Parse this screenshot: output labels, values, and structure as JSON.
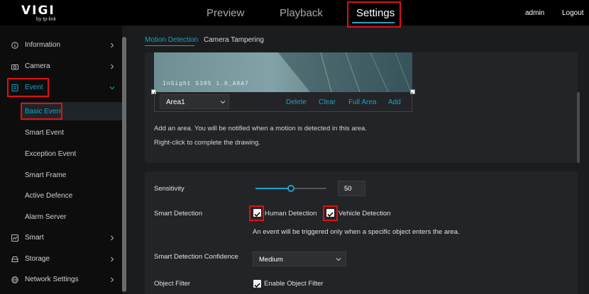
{
  "brand": {
    "name": "VIGI",
    "sub": "by tp-link"
  },
  "nav": {
    "tabs": [
      "Preview",
      "Playback",
      "Settings"
    ],
    "active": "Settings"
  },
  "user": {
    "name": "admin",
    "logout": "Logout"
  },
  "sidebar": {
    "items": [
      {
        "label": "Information",
        "icon": "info-icon"
      },
      {
        "label": "Camera",
        "icon": "camera-icon"
      },
      {
        "label": "Event",
        "icon": "event-icon"
      },
      {
        "label": "Smart",
        "icon": "smart-icon"
      },
      {
        "label": "Storage",
        "icon": "storage-icon"
      },
      {
        "label": "Network Settings",
        "icon": "network-icon"
      }
    ],
    "event_subitems": [
      "Basic Event",
      "Smart Event",
      "Exception Event",
      "Smart Frame",
      "Active Defence",
      "Alarm Server"
    ]
  },
  "subtabs": [
    "Motion Detection",
    "Camera Tampering"
  ],
  "preview": {
    "overlay": "InSight S385 1.0_A8A7"
  },
  "area": {
    "selected": "Area1",
    "actions": [
      "Delete",
      "Clear",
      "Full Area",
      "Add"
    ]
  },
  "help": {
    "line1": "Add an area. You will be notified when a motion is detected in this area.",
    "line2": "Right-click to complete the drawing."
  },
  "form": {
    "sensitivity_label": "Sensitivity",
    "sensitivity_value": "50",
    "sensitivity_level": 0.5,
    "smart_detection_label": "Smart Detection",
    "human_detection": "Human Detection",
    "vehicle_detection": "Vehicle Detection",
    "smart_note": "An event will be triggered only when a specific object enters the area.",
    "confidence_label": "Smart Detection Confidence",
    "confidence_value": "Medium",
    "object_filter_label": "Object Filter",
    "object_filter_option": "Enable Object Filter"
  },
  "colors": {
    "accent": "#19a3c7",
    "highlight": "#e01010"
  }
}
